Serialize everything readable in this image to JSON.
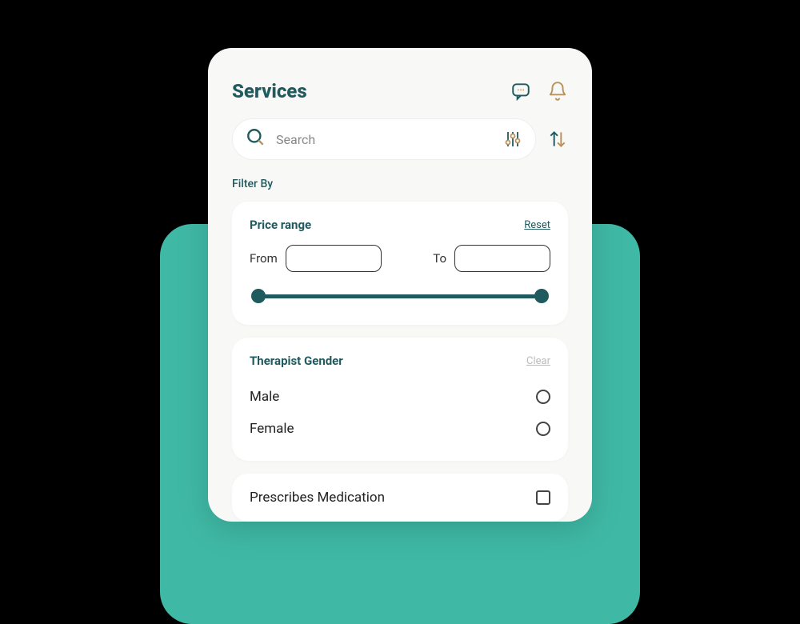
{
  "header": {
    "title": "Services"
  },
  "search": {
    "placeholder": "Search"
  },
  "filter": {
    "label": "Filter By",
    "price": {
      "title": "Price range",
      "reset": "Reset",
      "from_label": "From",
      "to_label": "To",
      "from_value": "",
      "to_value": ""
    },
    "gender": {
      "title": "Therapist Gender",
      "clear": "Clear",
      "options": [
        {
          "label": "Male"
        },
        {
          "label": "Female"
        }
      ]
    },
    "medication": {
      "label": "Prescribes Medication"
    }
  },
  "colors": {
    "accent": "#1f5a5f",
    "teal_bg": "#3fb9a5",
    "gold": "#b8925a"
  }
}
